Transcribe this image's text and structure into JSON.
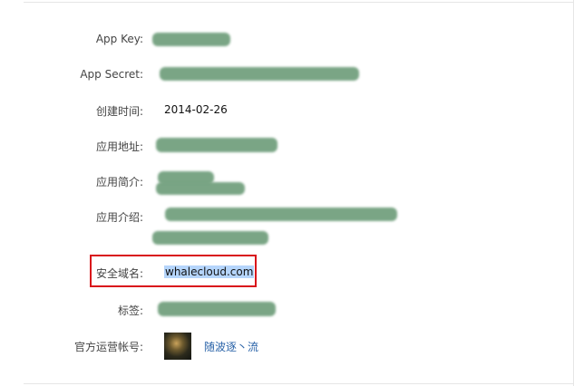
{
  "fields": {
    "app_key": {
      "label": "App Key:"
    },
    "app_secret": {
      "label": "App Secret:"
    },
    "created": {
      "label": "创建时间:",
      "value": "2014-02-26"
    },
    "app_url": {
      "label": "应用地址:"
    },
    "app_brief": {
      "label": "应用简介:"
    },
    "app_intro": {
      "label": "应用介绍:"
    },
    "security_domain": {
      "label": "安全域名:",
      "value": "whalecloud.com"
    },
    "tags": {
      "label": "标签:"
    },
    "official_account": {
      "label": "官方运营帐号:",
      "name": "随波逐丶流"
    }
  },
  "colors": {
    "highlight_border": "#d9141b",
    "selection": "#b5d5fb",
    "link": "#2a63a8",
    "redaction": "#6f9e7b"
  }
}
